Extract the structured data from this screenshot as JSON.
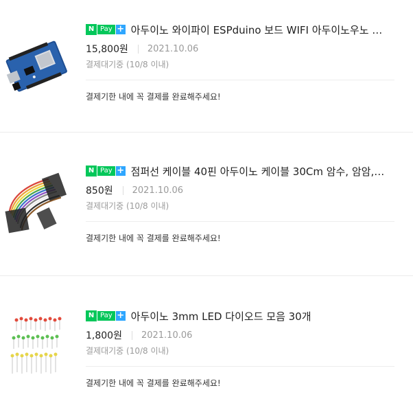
{
  "npay_badge": {
    "n": "N",
    "pay": "Pay",
    "plus": "+"
  },
  "orders": [
    {
      "title": "아두이노 와이파이 ESPduino 보드 WIFI 아두이노우노 …",
      "price": "15,800원",
      "date": "2021.10.06",
      "deadline": "결제대기중 (10/8 이내)",
      "notice": "결제기한 내에 꼭 결제를 완료해주세요!",
      "image": "esp-board-image"
    },
    {
      "title": "점퍼선 케이블 40핀 아두이노 케이블 30Cm 암수, 암암,…",
      "price": "850원",
      "date": "2021.10.06",
      "deadline": "결제대기중 (10/8 이내)",
      "notice": "결제기한 내에 꼭 결제를 완료해주세요!",
      "image": "jumper-cable-image"
    },
    {
      "title": "아두이노 3mm LED 다이오드 모음 30개",
      "price": "1,800원",
      "date": "2021.10.06",
      "deadline": "결제대기중 (10/8 이내)",
      "notice": "결제기한 내에 꼭 결제를 완료해주세요!",
      "image": "led-set-image"
    }
  ]
}
